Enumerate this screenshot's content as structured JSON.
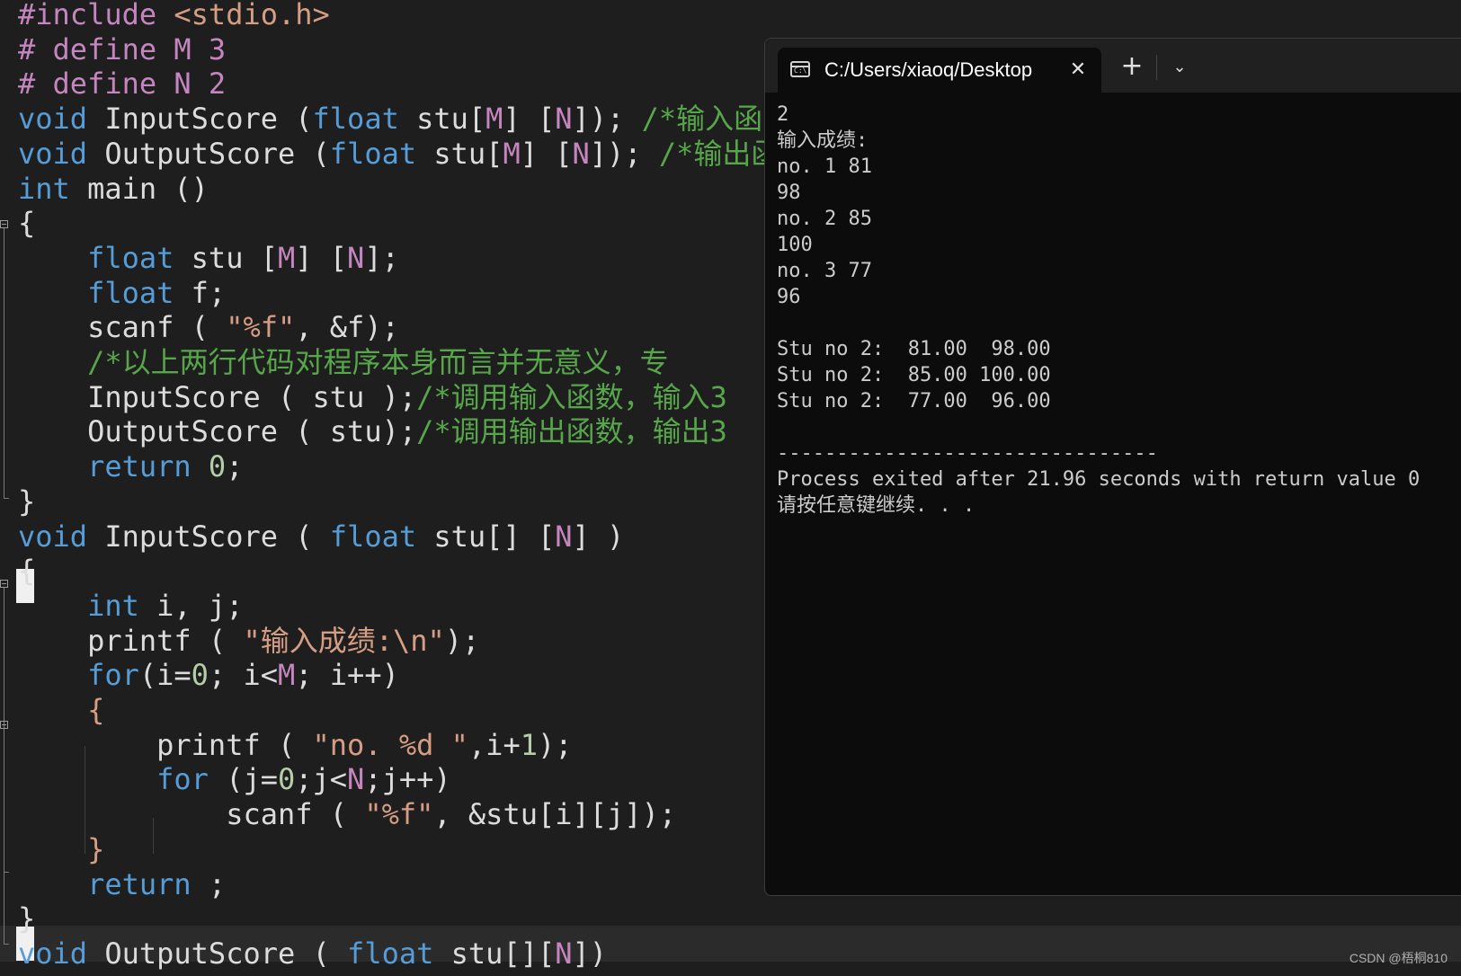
{
  "editor": {
    "lines": [
      [
        {
          "t": "#include ",
          "c": "pp"
        },
        {
          "t": "<stdio.h>",
          "c": "inc"
        }
      ],
      [
        {
          "t": "# define ",
          "c": "pp"
        },
        {
          "t": "M 3",
          "c": "mac"
        }
      ],
      [
        {
          "t": "# define ",
          "c": "pp"
        },
        {
          "t": "N 2",
          "c": "mac"
        }
      ],
      [
        {
          "t": "void ",
          "c": "kw"
        },
        {
          "t": "InputScore (",
          "c": "pl"
        },
        {
          "t": "float ",
          "c": "kw"
        },
        {
          "t": "stu[",
          "c": "pl"
        },
        {
          "t": "M",
          "c": "mac"
        },
        {
          "t": "] [",
          "c": "pl"
        },
        {
          "t": "N",
          "c": "mac"
        },
        {
          "t": "]); ",
          "c": "pl"
        },
        {
          "t": "/*输入函",
          "c": "cmt"
        }
      ],
      [
        {
          "t": "void ",
          "c": "kw"
        },
        {
          "t": "OutputScore (",
          "c": "pl"
        },
        {
          "t": "float ",
          "c": "kw"
        },
        {
          "t": "stu[",
          "c": "pl"
        },
        {
          "t": "M",
          "c": "mac"
        },
        {
          "t": "] [",
          "c": "pl"
        },
        {
          "t": "N",
          "c": "mac"
        },
        {
          "t": "]); ",
          "c": "pl"
        },
        {
          "t": "/*输出函",
          "c": "cmt"
        }
      ],
      [
        {
          "t": "int ",
          "c": "kw"
        },
        {
          "t": "main ()",
          "c": "pl"
        }
      ],
      [
        {
          "t": "{",
          "c": "pl"
        }
      ],
      [
        {
          "t": "    ",
          "c": "pl"
        },
        {
          "t": "float ",
          "c": "kw"
        },
        {
          "t": "stu [",
          "c": "pl"
        },
        {
          "t": "M",
          "c": "mac"
        },
        {
          "t": "] [",
          "c": "pl"
        },
        {
          "t": "N",
          "c": "mac"
        },
        {
          "t": "];",
          "c": "pl"
        }
      ],
      [
        {
          "t": "    ",
          "c": "pl"
        },
        {
          "t": "float ",
          "c": "kw"
        },
        {
          "t": "f;",
          "c": "pl"
        }
      ],
      [
        {
          "t": "    ",
          "c": "pl"
        },
        {
          "t": "scanf ( ",
          "c": "pl"
        },
        {
          "t": "\"%f\"",
          "c": "str"
        },
        {
          "t": ", &f);",
          "c": "pl"
        }
      ],
      [
        {
          "t": "    ",
          "c": "pl"
        },
        {
          "t": "/*以上两行代码对程序本身而言并无意义，专",
          "c": "cmt"
        }
      ],
      [
        {
          "t": "    ",
          "c": "pl"
        },
        {
          "t": "InputScore ( stu );",
          "c": "pl"
        },
        {
          "t": "/*调用输入函数，输入3",
          "c": "cmt"
        }
      ],
      [
        {
          "t": "    ",
          "c": "pl"
        },
        {
          "t": "OutputScore ( stu);",
          "c": "pl"
        },
        {
          "t": "/*调用输出函数，输出3",
          "c": "cmt"
        }
      ],
      [
        {
          "t": "    ",
          "c": "pl"
        },
        {
          "t": "return ",
          "c": "kw"
        },
        {
          "t": "0",
          "c": "num"
        },
        {
          "t": ";",
          "c": "pl"
        }
      ],
      [
        {
          "t": "}",
          "c": "pl"
        }
      ],
      [
        {
          "t": "void ",
          "c": "kw"
        },
        {
          "t": "InputScore ( ",
          "c": "pl"
        },
        {
          "t": "float ",
          "c": "kw"
        },
        {
          "t": "stu[] [",
          "c": "pl"
        },
        {
          "t": "N",
          "c": "mac"
        },
        {
          "t": "] )",
          "c": "pl"
        }
      ],
      [
        {
          "t": "{",
          "c": "pl"
        }
      ],
      [
        {
          "t": "    ",
          "c": "pl"
        },
        {
          "t": "int ",
          "c": "kw"
        },
        {
          "t": "i, j;",
          "c": "pl"
        }
      ],
      [
        {
          "t": "    ",
          "c": "pl"
        },
        {
          "t": "printf ( ",
          "c": "pl"
        },
        {
          "t": "\"输入成绩:\\n\"",
          "c": "str"
        },
        {
          "t": ");",
          "c": "pl"
        }
      ],
      [
        {
          "t": "    ",
          "c": "pl"
        },
        {
          "t": "for",
          "c": "kw"
        },
        {
          "t": "(i=",
          "c": "pl"
        },
        {
          "t": "0",
          "c": "num"
        },
        {
          "t": "; i<",
          "c": "pl"
        },
        {
          "t": "M",
          "c": "mac"
        },
        {
          "t": "; i++)",
          "c": "pl"
        }
      ],
      [
        {
          "t": "    ",
          "c": "pl"
        },
        {
          "t": "{",
          "c": "str"
        }
      ],
      [
        {
          "t": "        ",
          "c": "pl"
        },
        {
          "t": "printf ( ",
          "c": "pl"
        },
        {
          "t": "\"no. %d \"",
          "c": "str"
        },
        {
          "t": ",i+",
          "c": "pl"
        },
        {
          "t": "1",
          "c": "num"
        },
        {
          "t": ");",
          "c": "pl"
        }
      ],
      [
        {
          "t": "        ",
          "c": "pl"
        },
        {
          "t": "for ",
          "c": "kw"
        },
        {
          "t": "(j=",
          "c": "pl"
        },
        {
          "t": "0",
          "c": "num"
        },
        {
          "t": ";j<",
          "c": "pl"
        },
        {
          "t": "N",
          "c": "mac"
        },
        {
          "t": ";j++)",
          "c": "pl"
        }
      ],
      [
        {
          "t": "            ",
          "c": "pl"
        },
        {
          "t": "scanf ( ",
          "c": "pl"
        },
        {
          "t": "\"%f\"",
          "c": "str"
        },
        {
          "t": ", &stu[i][j]);",
          "c": "pl"
        }
      ],
      [
        {
          "t": "    ",
          "c": "pl"
        },
        {
          "t": "}",
          "c": "str"
        }
      ],
      [
        {
          "t": "    ",
          "c": "pl"
        },
        {
          "t": "return ",
          "c": "kw"
        },
        {
          "t": ";",
          "c": "pl"
        }
      ],
      [
        {
          "t": "}",
          "c": "pl"
        }
      ],
      [
        {
          "t": "void ",
          "c": "kw"
        },
        {
          "t": "OutputScore ( ",
          "c": "pl"
        },
        {
          "t": "float ",
          "c": "kw"
        },
        {
          "t": "stu[][",
          "c": "pl"
        },
        {
          "t": "N",
          "c": "mac"
        },
        {
          "t": "])",
          "c": "pl"
        }
      ]
    ]
  },
  "terminal": {
    "tab_title": "C:/Users/xiaoq/Desktop",
    "close_glyph": "✕",
    "new_tab_glyph": "+",
    "dropdown_glyph": "⌄",
    "icon_text": "C:\\",
    "output_lines": [
      "2",
      "输入成绩:",
      "no. 1 81",
      "98",
      "no. 2 85",
      "100",
      "no. 3 77",
      "96",
      "",
      "Stu no 2:  81.00  98.00",
      "Stu no 2:  85.00 100.00",
      "Stu no 2:  77.00  96.00",
      "",
      "--------------------------------",
      "Process exited after 21.96 seconds with return value 0",
      "请按任意键继续. . ."
    ]
  },
  "watermark": "CSDN @梧桐810"
}
